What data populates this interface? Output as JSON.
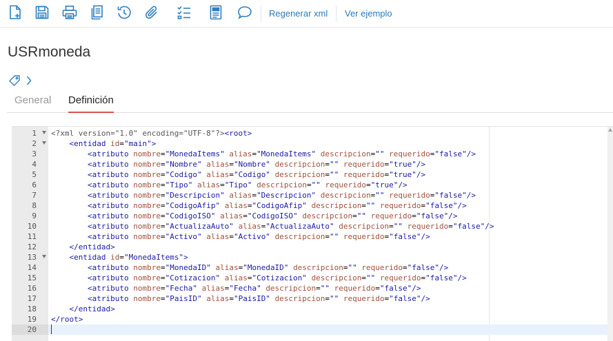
{
  "toolbar": {
    "icons": [
      {
        "name": "new-document-icon",
        "color": "#2f7fc1"
      },
      {
        "name": "save-icon",
        "color": "#2f7fc1"
      },
      {
        "name": "print-icon",
        "color": "#2f7fc1"
      },
      {
        "name": "copy-icon",
        "color": "#2f7fc1"
      },
      {
        "name": "history-icon",
        "color": "#2f7fc1"
      },
      {
        "name": "attach-icon",
        "color": "#2f7fc1"
      },
      {
        "name": "checklist-icon",
        "color": "#2f7fc1"
      },
      {
        "name": "form-icon",
        "color": "#2f7fc1"
      },
      {
        "name": "comment-icon",
        "color": "#2f7fc1"
      }
    ],
    "regenerate_label": "Regenerar xml",
    "example_label": "Ver ejemplo"
  },
  "page": {
    "title": "USRmoneda"
  },
  "tabs": [
    {
      "label": "General",
      "active": false
    },
    {
      "label": "Definición",
      "active": true
    }
  ],
  "colors": {
    "accent": "#2f7fc1",
    "link": "#2a7ab8",
    "active_tab_underline": "#d9534f",
    "xml_tag": "#1a1aa6",
    "xml_attr": "#a0513c",
    "xml_string": "#1a1aa6"
  },
  "editor": {
    "active_line": 20,
    "lines": [
      {
        "n": "1",
        "fold": true,
        "text": "<?xml version=\"1.0\" encoding=\"UTF-8\"?><root>"
      },
      {
        "n": "2",
        "fold": true,
        "text": "    <entidad id=\"main\">"
      },
      {
        "n": "3",
        "fold": false,
        "text": "        <atributo nombre=\"MonedaItems\" alias=\"MonedaItems\" descripcion=\"\" requerido=\"false\"/>"
      },
      {
        "n": "4",
        "fold": false,
        "text": "        <atributo nombre=\"Nombre\" alias=\"Nombre\" descripcion=\"\" requerido=\"true\"/>"
      },
      {
        "n": "5",
        "fold": false,
        "text": "        <atributo nombre=\"Codigo\" alias=\"Codigo\" descripcion=\"\" requerido=\"true\"/>"
      },
      {
        "n": "6",
        "fold": false,
        "text": "        <atributo nombre=\"Tipo\" alias=\"Tipo\" descripcion=\"\" requerido=\"true\"/>"
      },
      {
        "n": "7",
        "fold": false,
        "text": "        <atributo nombre=\"Descripcion\" alias=\"Descripcion\" descripcion=\"\" requerido=\"false\"/>"
      },
      {
        "n": "8",
        "fold": false,
        "text": "        <atributo nombre=\"CodigoAfip\" alias=\"CodigoAfip\" descripcion=\"\" requerido=\"false\"/>"
      },
      {
        "n": "9",
        "fold": false,
        "text": "        <atributo nombre=\"CodigoISO\" alias=\"CodigoISO\" descripcion=\"\" requerido=\"false\"/>"
      },
      {
        "n": "10",
        "fold": false,
        "text": "        <atributo nombre=\"ActualizaAuto\" alias=\"ActualizaAuto\" descripcion=\"\" requerido=\"false\"/>"
      },
      {
        "n": "11",
        "fold": false,
        "text": "        <atributo nombre=\"Activo\" alias=\"Activo\" descripcion=\"\" requerido=\"false\"/>"
      },
      {
        "n": "12",
        "fold": false,
        "text": "    </entidad>"
      },
      {
        "n": "13",
        "fold": true,
        "text": "    <entidad id=\"MonedaItems\">"
      },
      {
        "n": "14",
        "fold": false,
        "text": "        <atributo nombre=\"MonedaID\" alias=\"MonedaID\" descripcion=\"\" requerido=\"false\"/>"
      },
      {
        "n": "15",
        "fold": false,
        "text": "        <atributo nombre=\"Cotizacion\" alias=\"Cotizacion\" descripcion=\"\" requerido=\"false\"/>"
      },
      {
        "n": "16",
        "fold": false,
        "text": "        <atributo nombre=\"Fecha\" alias=\"Fecha\" descripcion=\"\" requerido=\"false\"/>"
      },
      {
        "n": "17",
        "fold": false,
        "text": "        <atributo nombre=\"PaisID\" alias=\"PaisID\" descripcion=\"\" requerido=\"false\"/>"
      },
      {
        "n": "18",
        "fold": false,
        "text": "    </entidad>"
      },
      {
        "n": "19",
        "fold": false,
        "text": "</root>"
      },
      {
        "n": "20",
        "fold": false,
        "text": ""
      }
    ]
  }
}
